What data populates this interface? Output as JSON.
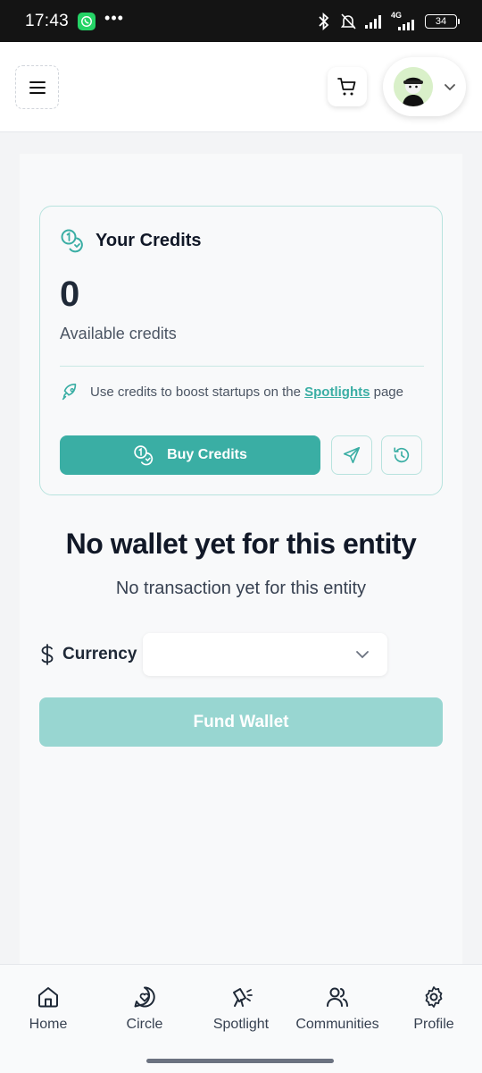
{
  "status_bar": {
    "time": "17:43",
    "dots": "•••",
    "network": "4G",
    "battery": "34"
  },
  "header": {
    "menu_icon": "hamburger-icon",
    "cart_icon": "cart-icon",
    "avatar_icon": "avatar-image",
    "dropdown_icon": "chevron-down-icon"
  },
  "credits": {
    "title": "Your Credits",
    "amount": "0",
    "subtitle": "Available credits",
    "note_prefix": "Use credits to boost startups on the ",
    "note_link": "Spotlights",
    "note_suffix": " page",
    "buy_label": "Buy Credits"
  },
  "wallet": {
    "empty_title": "No wallet yet for this entity",
    "empty_subtitle": "No transaction yet for this entity",
    "currency_label": "Currency",
    "currency_value": "",
    "fund_label": "Fund Wallet"
  },
  "nav": {
    "items": [
      {
        "label": "Home",
        "icon": "home-icon"
      },
      {
        "label": "Circle",
        "icon": "heart-chat-icon"
      },
      {
        "label": "Spotlight",
        "icon": "spotlight-icon"
      },
      {
        "label": "Communities",
        "icon": "users-icon"
      },
      {
        "label": "Profile",
        "icon": "gear-icon"
      }
    ]
  },
  "colors": {
    "accent": "#3aaea4",
    "accent_light": "#98d6d1",
    "border": "#b8e3de"
  }
}
